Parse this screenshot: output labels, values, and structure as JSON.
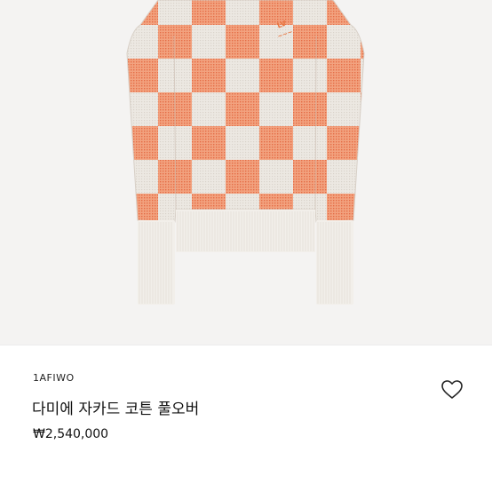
{
  "product": {
    "sku": "1AFIWO",
    "name": "다미에 자카드 코튼 풀오버",
    "price": "₩2,540,000",
    "image": {
      "subject": "checkered knit pullover",
      "colors": {
        "orange": "#ef8a63",
        "cream": "#e9e5df",
        "trim": "#f2efea"
      }
    },
    "wishlist_icon": "heart-outline-icon"
  }
}
